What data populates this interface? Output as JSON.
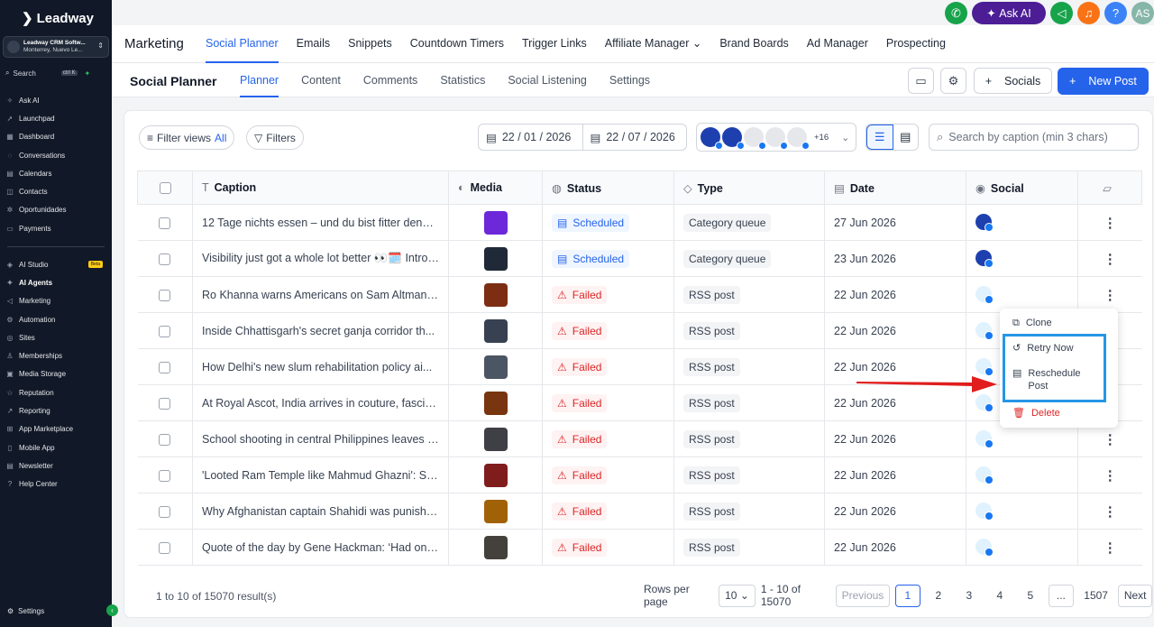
{
  "sidebar": {
    "logo": "Leadway",
    "account_name": "Leadway CRM Softw...",
    "account_location": "Monterrey, Nuevo Le...",
    "search_label": "Search",
    "search_shortcut": "ctrl K",
    "group1": [
      "Ask AI",
      "Launchpad",
      "Dashboard",
      "Conversations",
      "Calendars",
      "Contacts",
      "Oportunidades",
      "Payments"
    ],
    "group2": [
      "AI Studio",
      "AI Agents",
      "Marketing",
      "Automation",
      "Sites",
      "Memberships",
      "Media Storage",
      "Reputation",
      "Reporting",
      "App Marketplace",
      "Mobile App",
      "Newsletter",
      "Help Center"
    ],
    "beta": "Beta",
    "settings": "Settings"
  },
  "header": {
    "section": "Marketing",
    "tabs": [
      "Social Planner",
      "Emails",
      "Snippets",
      "Countdown Timers",
      "Trigger Links",
      "Affiliate Manager",
      "Brand Boards",
      "Ad Manager",
      "Prospecting"
    ],
    "ask_ai": "Ask AI",
    "avatar": "AS",
    "help": "?"
  },
  "subnav": {
    "title": "Social Planner",
    "tabs": [
      "Planner",
      "Content",
      "Comments",
      "Statistics",
      "Social Listening",
      "Settings"
    ],
    "socials_label": "Socials",
    "new_post_label": "New Post"
  },
  "filters": {
    "filter_views": "Filter views",
    "filter_views_value": "All",
    "filters": "Filters",
    "date_from": "22 / 01 / 2026",
    "date_to": "22 / 07 / 2026",
    "accounts_more": "+16",
    "search_placeholder": "Search by caption (min 3 chars)"
  },
  "table": {
    "headers": [
      "Caption",
      "Media",
      "Status",
      "Type",
      "Date",
      "Social"
    ],
    "rows": [
      {
        "caption": "12 Tage nichts essen – und du bist fitter denn ...",
        "status": "Scheduled",
        "type": "Category queue",
        "date": "27 Jun 2026"
      },
      {
        "caption": "Visibility just got a whole lot better 👀🗓️ Introd...",
        "status": "Scheduled",
        "type": "Category queue",
        "date": "23 Jun 2026"
      },
      {
        "caption": "Ro Khanna warns Americans on Sam Altman &...",
        "status": "Failed",
        "type": "RSS post",
        "date": "22 Jun 2026"
      },
      {
        "caption": "Inside Chhattisgarh's secret ganja corridor th...",
        "status": "Failed",
        "type": "RSS post",
        "date": "22 Jun 2026"
      },
      {
        "caption": "How Delhi's new slum rehabilitation policy ai...",
        "status": "Failed",
        "type": "RSS post",
        "date": "22 Jun 2026"
      },
      {
        "caption": "At Royal Ascot, India arrives in couture, fascin...",
        "status": "Failed",
        "type": "RSS post",
        "date": "22 Jun 2026"
      },
      {
        "caption": "School shooting in central Philippines leaves t...",
        "status": "Failed",
        "type": "RSS post",
        "date": "22 Jun 2026"
      },
      {
        "caption": "'Looted Ram Temple like Mahmud Ghazni': Se...",
        "status": "Failed",
        "type": "RSS post",
        "date": "22 Jun 2026"
      },
      {
        "caption": "Why Afghanistan captain Shahidi was punishe...",
        "status": "Failed",
        "type": "RSS post",
        "date": "22 Jun 2026"
      },
      {
        "caption": "Quote of the day by Gene Hackman: ‘Had only...",
        "status": "Failed",
        "type": "RSS post",
        "date": "22 Jun 2026"
      }
    ]
  },
  "footer": {
    "results": "1 to 10 of 15070 result(s)",
    "rows_per_page_label": "Rows per page",
    "rows_per_page": "10",
    "range": "1 - 10 of 15070",
    "previous": "Previous",
    "pages": [
      "1",
      "2",
      "3",
      "4",
      "5"
    ],
    "ellipsis": "...",
    "last_page": "1507",
    "next": "Next"
  },
  "context_menu": {
    "clone": "Clone",
    "retry": "Retry Now",
    "reschedule_line1": "Reschedule",
    "reschedule_line2": "Post",
    "delete": "Delete"
  },
  "colors": {
    "accent": "#2563eb",
    "failed": "#dc2626",
    "sidebar_bg": "#111827",
    "highlight": "#2596e6",
    "arrow": "#e11d1d"
  }
}
